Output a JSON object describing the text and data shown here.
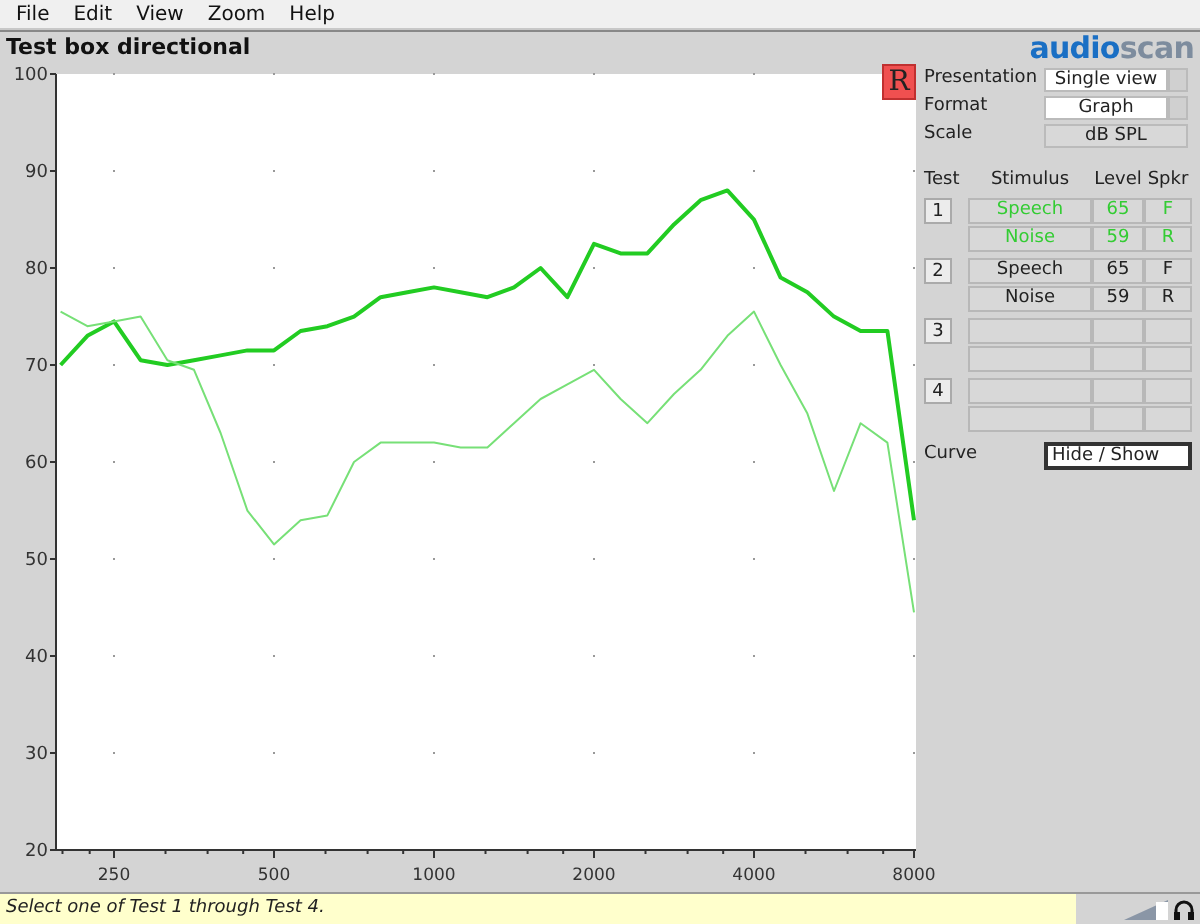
{
  "menu": [
    "File",
    "Edit",
    "View",
    "Zoom",
    "Help"
  ],
  "title": "Test box directional",
  "logo": {
    "part_1": "audio",
    "part_2": "scan"
  },
  "red_button": "R",
  "settings": [
    {
      "label": "Presentation",
      "value": "Single view",
      "kind": "select"
    },
    {
      "label": "Format",
      "value": "Graph",
      "kind": "select"
    },
    {
      "label": "Scale",
      "value": "dB SPL",
      "kind": "readonly"
    }
  ],
  "tests_header": {
    "test": "Test",
    "stimulus": "Stimulus",
    "level": "Level",
    "spkr": "Spkr"
  },
  "tests": [
    {
      "label": "1",
      "color": "#33cc33",
      "rows": [
        {
          "stimulus": "Speech",
          "level": "65",
          "spkr": "F"
        },
        {
          "stimulus": "Noise",
          "level": "59",
          "spkr": "R"
        }
      ]
    },
    {
      "label": "2",
      "color": "#222222",
      "rows": [
        {
          "stimulus": "Speech",
          "level": "65",
          "spkr": "F"
        },
        {
          "stimulus": "Noise",
          "level": "59",
          "spkr": "R"
        }
      ]
    },
    {
      "label": "3"
    },
    {
      "label": "4"
    }
  ],
  "curve": {
    "label": "Curve",
    "button": "Hide / Show"
  },
  "chart_data": {
    "type": "line",
    "categories": [
      null,
      null,
      "250",
      null,
      null,
      null,
      null,
      null,
      "500",
      null,
      null,
      null,
      null,
      null,
      "1000",
      null,
      null,
      null,
      null,
      null,
      "2000",
      null,
      null,
      null,
      null,
      null,
      "4000",
      null,
      null,
      null,
      null,
      null,
      "8000"
    ],
    "series": [
      {
        "color": "#22cc22",
        "values": [
          70,
          73,
          74.5,
          70.5,
          70,
          70.5,
          71,
          71.5,
          71.5,
          73.5,
          74,
          75,
          77,
          77.5,
          78,
          77.5,
          77,
          78,
          80,
          77,
          82.5,
          81.5,
          81.5,
          84.5,
          87,
          88,
          85,
          79,
          77.5,
          75,
          73.5,
          73.5,
          54
        ]
      },
      {
        "color": "#77e077",
        "values": [
          75.5,
          74,
          74.5,
          75,
          70.5,
          69.5,
          63,
          55,
          51.5,
          54,
          54.5,
          60,
          62,
          62,
          62,
          61.5,
          61.5,
          64,
          66.5,
          68,
          69.5,
          66.5,
          64,
          67,
          69.5,
          73,
          75.5,
          70,
          65,
          57,
          64,
          62,
          44.5
        ]
      }
    ],
    "ylim": [
      20,
      100
    ],
    "yticks": [
      20,
      30,
      40,
      50,
      60,
      70,
      80,
      90,
      100
    ]
  },
  "status": "Select one of Test 1 through Test 4."
}
